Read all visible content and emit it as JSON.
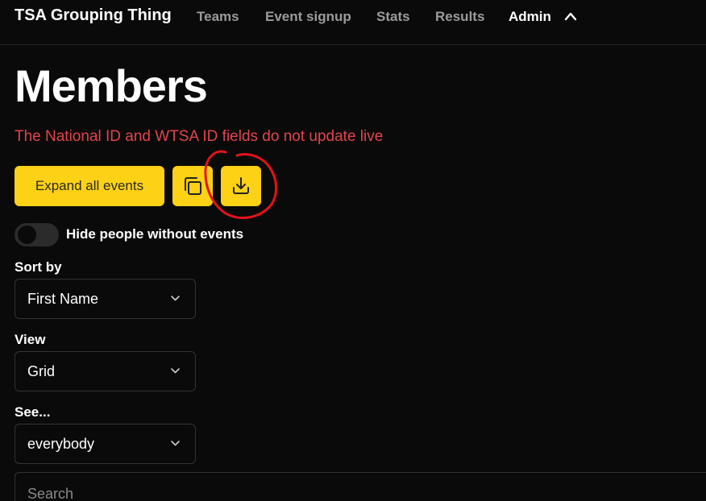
{
  "nav": {
    "brand": "TSA Grouping Thing",
    "links": [
      "Teams",
      "Event signup",
      "Stats",
      "Results",
      "Admin"
    ],
    "active": "Admin"
  },
  "header": {
    "title": "Members",
    "warning": "The National ID and WTSA ID fields do not update live"
  },
  "actions": {
    "expand_label": "Expand all events",
    "copy_icon": "copy-icon",
    "download_icon": "download-icon"
  },
  "toggle": {
    "label": "Hide people without events",
    "on": false
  },
  "sort": {
    "label": "Sort by",
    "value": "First Name"
  },
  "view": {
    "label": "View",
    "value": "Grid"
  },
  "see": {
    "label": "See...",
    "value": "everybody"
  },
  "search": {
    "placeholder": "Search",
    "value": ""
  },
  "colors": {
    "accent": "#fcd116",
    "warning": "#e0444a",
    "annotation": "#e4121b",
    "background": "#0b0a0a"
  }
}
